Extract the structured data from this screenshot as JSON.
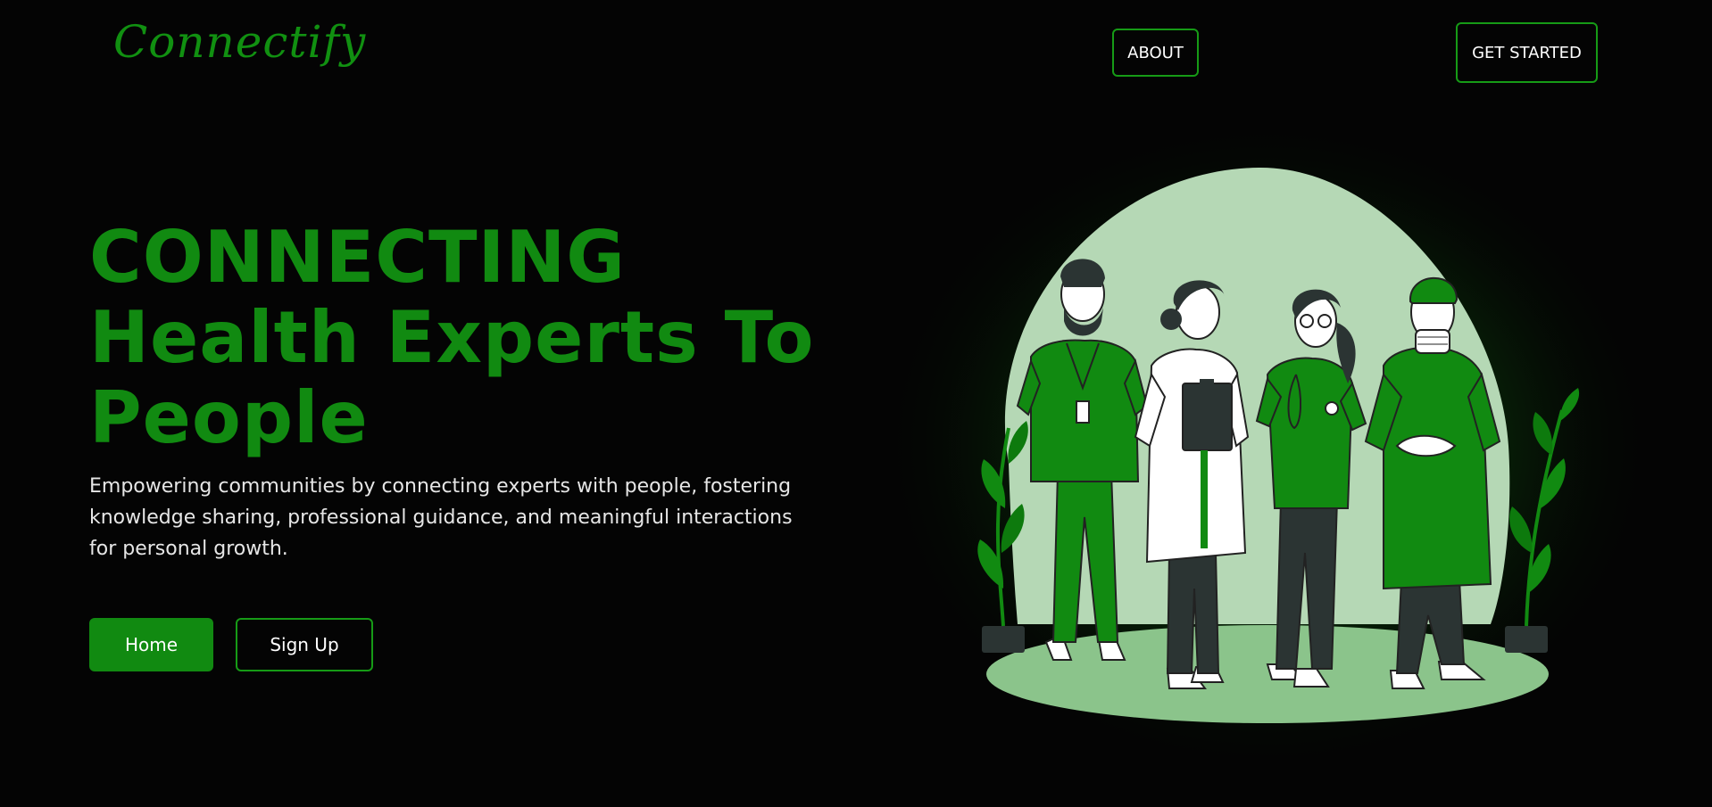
{
  "brand": {
    "logo_text": "Connectify",
    "accent": "#118a11",
    "border_green": "#169b16",
    "background": "#040404"
  },
  "nav": {
    "about_label": "ABOUT",
    "get_started_label": "GET STARTED"
  },
  "hero": {
    "headline_line1": "CONNECTING",
    "headline_line2": "Health Experts To",
    "headline_line3": "People",
    "description": "Empowering communities by connecting experts with people, fostering knowledge sharing, professional guidance, and meaningful interactions for personal growth.",
    "home_label": "Home",
    "signup_label": "Sign Up"
  },
  "illustration": {
    "icon": "health-experts-illustration"
  }
}
